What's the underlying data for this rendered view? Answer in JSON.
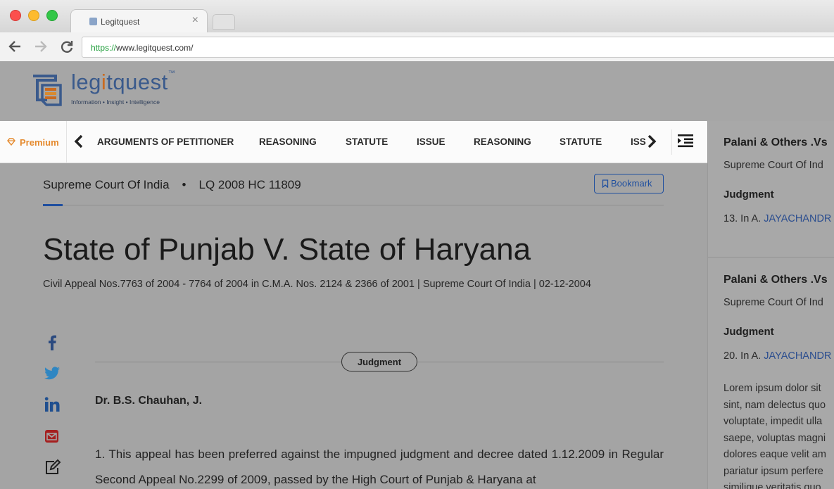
{
  "browser": {
    "tab_title": "Legitquest",
    "tab_close": "×",
    "url_protocol": "https://",
    "url_rest": "www.legitquest.com/"
  },
  "site": {
    "logo_text_pre": "leg",
    "logo_text_i": "i",
    "logo_text_post": "tquest",
    "logo_tm": "™",
    "tagline": "Information • Insight • Intelligence"
  },
  "toolbar": {
    "premium_label": "Premium",
    "items": [
      "ARGUMENTS OF PETITIONER",
      "REASONING",
      "STATUTE",
      "ISSUE",
      "REASONING",
      "STATUTE"
    ],
    "clipped_item": "ISSUE"
  },
  "article": {
    "court": "Supreme Court Of India",
    "separator": "•",
    "citation": "LQ 2008 HC 11809",
    "bookmark_label": "Bookmark",
    "title": "State of Punjab V. State of Haryana",
    "subtitle": "Civil Appeal Nos.7763 of 2004 - 7764 of 2004 in C.M.A. Nos. 2124 & 2366 of 2001 | Supreme Court Of India | 02-12-2004",
    "section_label": "Judgment",
    "judge": "Dr. B.S. Chauhan, J.",
    "paragraph": "1. This appeal has been preferred against the impugned judgment and decree dated 1.12.2009 in Regular Second Appeal No.2299 of 2009, passed by the High Court of Punjab & Haryana at"
  },
  "sidebar": {
    "cards": [
      {
        "title": "Palani & Others .Vs",
        "court": "Supreme Court Of Ind",
        "heading": "Judgment",
        "text_prefix": "13. In A. ",
        "text_link": "JAYACHANDR"
      },
      {
        "title": "Palani & Others .Vs",
        "court": "Supreme Court Of Ind",
        "heading": "Judgment",
        "text_prefix": "20. In A. ",
        "text_link": "JAYACHANDR",
        "lorem": [
          "Lorem ipsum dolor sit",
          "sint, nam delectus quo",
          "voluptate, impedit ulla",
          "saepe, voluptas magni",
          "dolores eaque velit am",
          "pariatur ipsum perfere",
          "similique veritatis quo"
        ]
      }
    ]
  },
  "colors": {
    "brand_blue": "#3a5a8c",
    "accent_orange": "#e58a2e",
    "link_blue": "#2a4d8f",
    "overlay_gray": "#a4a4a4"
  }
}
